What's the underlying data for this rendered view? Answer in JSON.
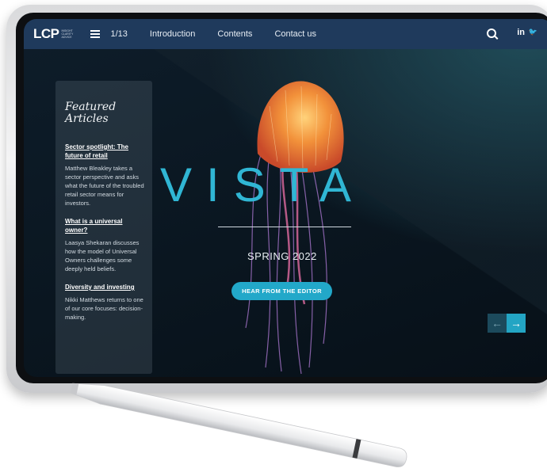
{
  "nav": {
    "logo": "LCP",
    "logo_sub": "INSIGHT CLARITY ADVICE",
    "page": "1/13",
    "items": [
      "Introduction",
      "Contents",
      "Contact us"
    ],
    "social": [
      "in",
      "🐦"
    ]
  },
  "panel": {
    "title_line1": "Featured",
    "title_line2": "Articles",
    "articles": [
      {
        "title": "Sector spotlight: The future of retail",
        "body": "Matthew Bleakley takes a sector perspective and asks what the future of the troubled retail sector means for investors."
      },
      {
        "title": "What is a universal owner?",
        "body": "Laasya Shekaran discusses how the model of Universal Owners challenges some deeply held beliefs."
      },
      {
        "title": "Diversity and investing",
        "body": "Nikki Matthews returns to one of our core focuses: decision-making."
      }
    ]
  },
  "hero": {
    "title": "VISTA",
    "edition": "SPRING 2022",
    "cta": "HEAR FROM THE EDITOR"
  },
  "colors": {
    "nav_bg": "#1f3a5c",
    "accent": "#23a5c4"
  }
}
